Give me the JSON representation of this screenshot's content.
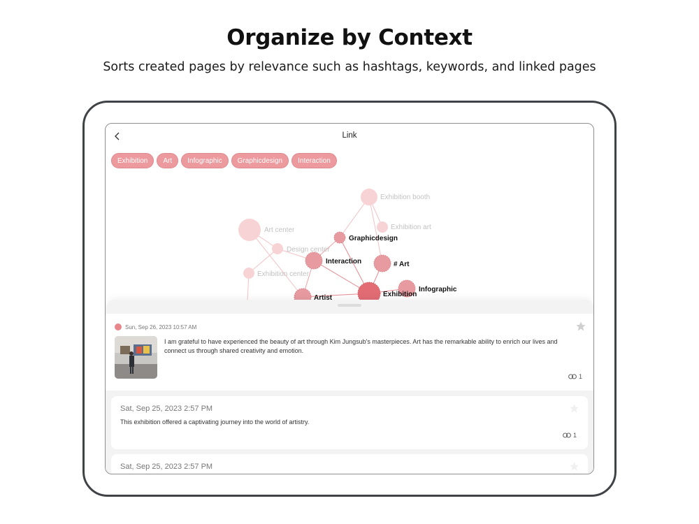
{
  "headline": "Organize by Context",
  "subheadline": "Sorts created pages by relevance such as hashtags, keywords, and linked pages",
  "screen": {
    "title": "Link",
    "back_icon": "chevron-left-icon"
  },
  "chips": [
    "Exhibition",
    "Art",
    "Infographic",
    "Graphicdesign",
    "Interaction"
  ],
  "graph": {
    "nodes": [
      {
        "id": "exhibition_booth",
        "label": "Exhibition booth"
      },
      {
        "id": "exhibition_art",
        "label": "Exhibition art"
      },
      {
        "id": "art_center",
        "label": "Art center"
      },
      {
        "id": "graphicdesign",
        "label": "Graphicdesign"
      },
      {
        "id": "design_center",
        "label": "Design center"
      },
      {
        "id": "interaction",
        "label": "Interaction"
      },
      {
        "id": "hash_art",
        "label": "# Art"
      },
      {
        "id": "exhibition_center",
        "label": "Exhibition center"
      },
      {
        "id": "infographic",
        "label": "Infographic"
      },
      {
        "id": "artist",
        "label": "Artist"
      },
      {
        "id": "exhibition",
        "label": "Exhibition"
      }
    ]
  },
  "entries": [
    {
      "date": "Sun, Sep 26, 2023 10:57 AM",
      "body_line1": "I am grateful to have experienced the beauty of art through Kim Jungsub's masterpieces. Art has the remarkable ability to enrich our lives and",
      "body_line2": "connect us through shared creativity and emotion.",
      "links": "1",
      "starred": true
    },
    {
      "date": "Sat, Sep 25, 2023 2:57 PM",
      "body": "This exhibition offered a captivating journey into the world of artistry.",
      "links": "1",
      "starred": false
    },
    {
      "date": "Sat, Sep 25, 2023 2:57 PM",
      "starred": false
    }
  ],
  "colors": {
    "accent": "#e7868b",
    "chip": "#ec9a9e",
    "node_strong": "#e26c74",
    "node_faded": "#f8d3d5",
    "device_frame": "#3f4246"
  }
}
